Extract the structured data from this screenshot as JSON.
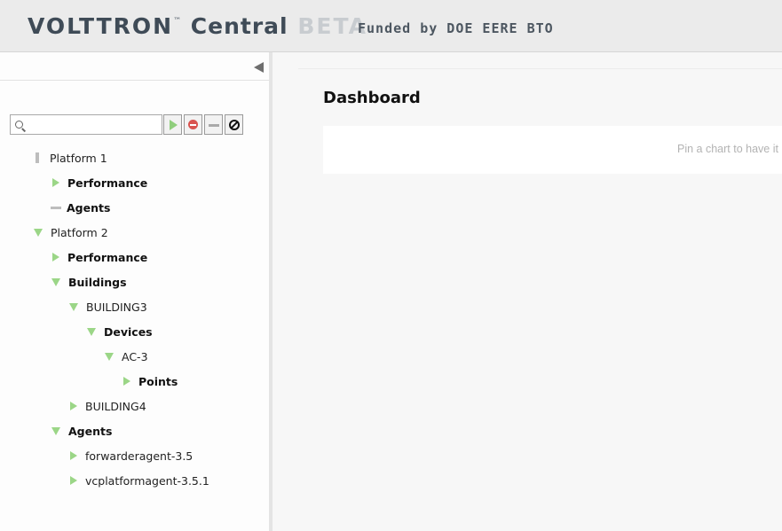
{
  "header": {
    "brand": "VOLTTRON",
    "trademark": "™",
    "product": "Central",
    "beta": "BETA",
    "funded": "Funded by DOE EERE BTO"
  },
  "sidebar": {
    "collapse_icon": "triangle-left-icon",
    "search": {
      "value": "",
      "placeholder": "",
      "icon": "search-icon"
    },
    "filter_buttons": [
      {
        "name": "filter-status-green-button",
        "icon": "play-triangle-icon"
      },
      {
        "name": "filter-status-red-button",
        "icon": "minus-circle-icon"
      },
      {
        "name": "filter-status-unknown-button",
        "icon": "gray-bar-icon"
      },
      {
        "name": "clear-filter-button",
        "icon": "ban-icon"
      }
    ],
    "tree": [
      {
        "label": "Platform 1",
        "level": 0,
        "icon": "vertical-bar",
        "bold": false
      },
      {
        "label": "Performance",
        "level": 1,
        "icon": "collapsed",
        "bold": true
      },
      {
        "label": "Agents",
        "level": 1,
        "icon": "horizontal-bar",
        "bold": true
      },
      {
        "label": "Platform 2",
        "level": 0,
        "icon": "expanded",
        "bold": false
      },
      {
        "label": "Performance",
        "level": 1,
        "icon": "collapsed",
        "bold": true
      },
      {
        "label": "Buildings",
        "level": 1,
        "icon": "expanded",
        "bold": true
      },
      {
        "label": "BUILDING3",
        "level": 2,
        "icon": "expanded",
        "bold": false
      },
      {
        "label": "Devices",
        "level": 3,
        "icon": "expanded",
        "bold": true
      },
      {
        "label": "AC-3",
        "level": 4,
        "icon": "expanded",
        "bold": false
      },
      {
        "label": "Points",
        "level": 5,
        "icon": "collapsed",
        "bold": true
      },
      {
        "label": "BUILDING4",
        "level": 2,
        "icon": "collapsed",
        "bold": false
      },
      {
        "label": "Agents",
        "level": 1,
        "icon": "expanded",
        "bold": true
      },
      {
        "label": "forwarderagent-3.5",
        "level": 2,
        "icon": "collapsed",
        "bold": false
      },
      {
        "label": "vcplatformagent-3.5.1",
        "level": 2,
        "icon": "collapsed",
        "bold": false
      }
    ]
  },
  "main": {
    "title": "Dashboard",
    "empty_message": "Pin a chart to have it"
  },
  "colors": {
    "accent_green": "#9bd687",
    "status_red": "#d9534f",
    "header_bg": "#ebebeb",
    "brand_text": "#3f4b57"
  }
}
